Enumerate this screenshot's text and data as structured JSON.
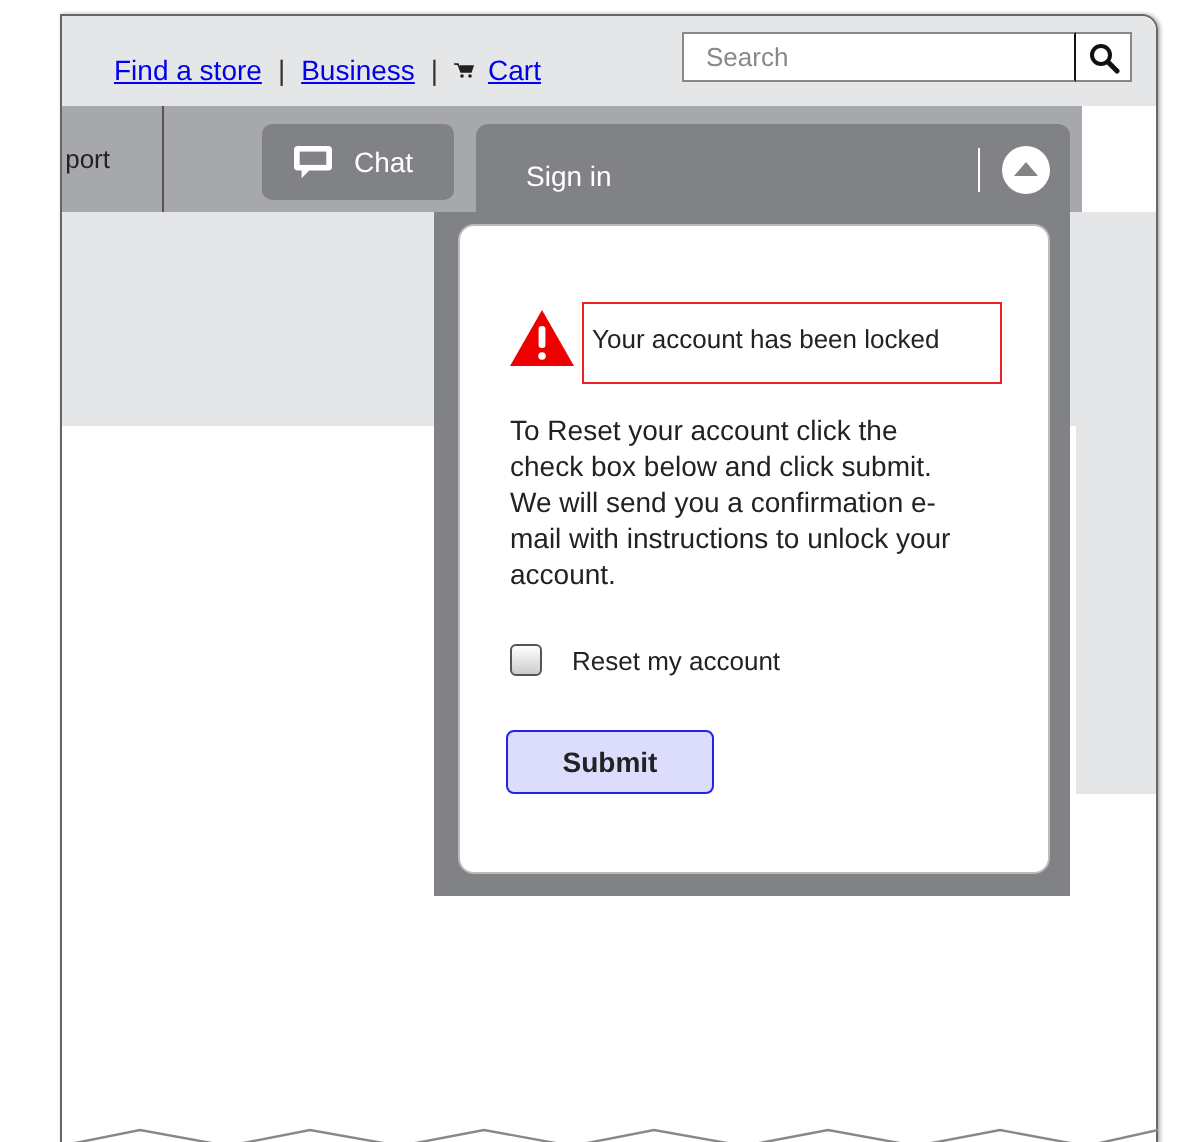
{
  "header": {
    "links": [
      {
        "kind": "link",
        "label": "Find a store"
      },
      {
        "kind": "link",
        "label": "Business"
      },
      {
        "kind": "cart",
        "label": "Cart"
      }
    ],
    "separator": "|",
    "search": {
      "placeholder": "Search"
    }
  },
  "nav": {
    "items": [
      {
        "label": "port"
      }
    ],
    "chat_button": "Chat"
  },
  "sign_in": {
    "title": "Sign in",
    "expanded": true,
    "alert": {
      "message": "Your account has been locked"
    },
    "instructions": "To Reset your account click the check box below and click submit. We will send you a confirmation e-mail with instructions to unlock your account.",
    "checkbox": {
      "label": "Reset my account",
      "checked": false
    },
    "submit_button": "Submit"
  }
}
